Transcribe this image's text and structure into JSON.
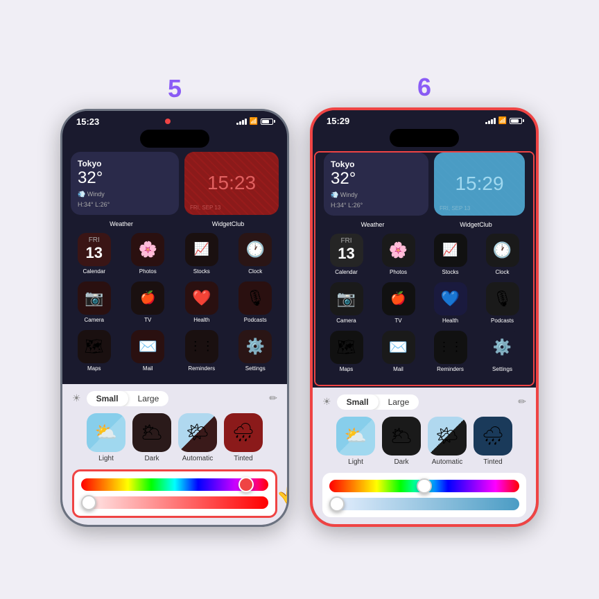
{
  "page": {
    "background": "#f0eef5"
  },
  "phone5": {
    "step": "5",
    "time": "15:23",
    "widgets": {
      "weather": {
        "city": "Tokyo",
        "temp": "32°",
        "wind": "~",
        "condition": "Windy",
        "range": "H:34° L:26°"
      },
      "clock_time": "15:23",
      "clock_date": "FRI, SEP 13",
      "weather_label": "Weather",
      "clock_label": "WidgetClub"
    },
    "apps": [
      {
        "label": "Calendar",
        "row": 1
      },
      {
        "label": "Photos",
        "row": 1
      },
      {
        "label": "Stocks",
        "row": 1
      },
      {
        "label": "Clock",
        "row": 1
      },
      {
        "label": "Camera",
        "row": 2
      },
      {
        "label": "TV",
        "row": 2
      },
      {
        "label": "Health",
        "row": 2
      },
      {
        "label": "Podcasts",
        "row": 2
      },
      {
        "label": "Maps",
        "row": 3
      },
      {
        "label": "Mail",
        "row": 3
      },
      {
        "label": "Reminders",
        "row": 3
      },
      {
        "label": "Settings",
        "row": 3
      }
    ],
    "bottom": {
      "small_label": "Small",
      "large_label": "Large",
      "theme_options": [
        "Light",
        "Dark",
        "Automatic",
        "Tinted"
      ],
      "active_size": "Small"
    },
    "sliders": {
      "hue_thumb_position": "88%",
      "sat_thumb_position": "0%"
    }
  },
  "phone6": {
    "step": "6",
    "time": "15:29",
    "widgets": {
      "weather": {
        "city": "Tokyo",
        "temp": "32°",
        "wind": "~",
        "condition": "Windy",
        "range": "H:34° L:26°"
      },
      "clock_time": "15:29",
      "clock_date": "FRI, SEP 13",
      "weather_label": "Weather",
      "clock_label": "WidgetClub"
    },
    "apps": [
      {
        "label": "Calendar",
        "row": 1
      },
      {
        "label": "Photos",
        "row": 1
      },
      {
        "label": "Stocks",
        "row": 1
      },
      {
        "label": "Clock",
        "row": 1
      },
      {
        "label": "Camera",
        "row": 2
      },
      {
        "label": "TV",
        "row": 2
      },
      {
        "label": "Health",
        "row": 2
      },
      {
        "label": "Podcasts",
        "row": 2
      },
      {
        "label": "Maps",
        "row": 3
      },
      {
        "label": "Mail",
        "row": 3
      },
      {
        "label": "Reminders",
        "row": 3
      },
      {
        "label": "Settings",
        "row": 3
      }
    ],
    "bottom": {
      "small_label": "Small",
      "large_label": "Large",
      "theme_options": [
        "Light",
        "Dark",
        "Automatic",
        "Tinted"
      ],
      "active_size": "Small"
    },
    "sliders": {
      "hue_thumb_position": "50%",
      "sat_thumb_position": "0%"
    }
  },
  "labels": {
    "light": "Light",
    "dark": "Dark",
    "automatic": "Automatic",
    "tinted": "Tinted",
    "small": "Small",
    "large": "Large"
  }
}
